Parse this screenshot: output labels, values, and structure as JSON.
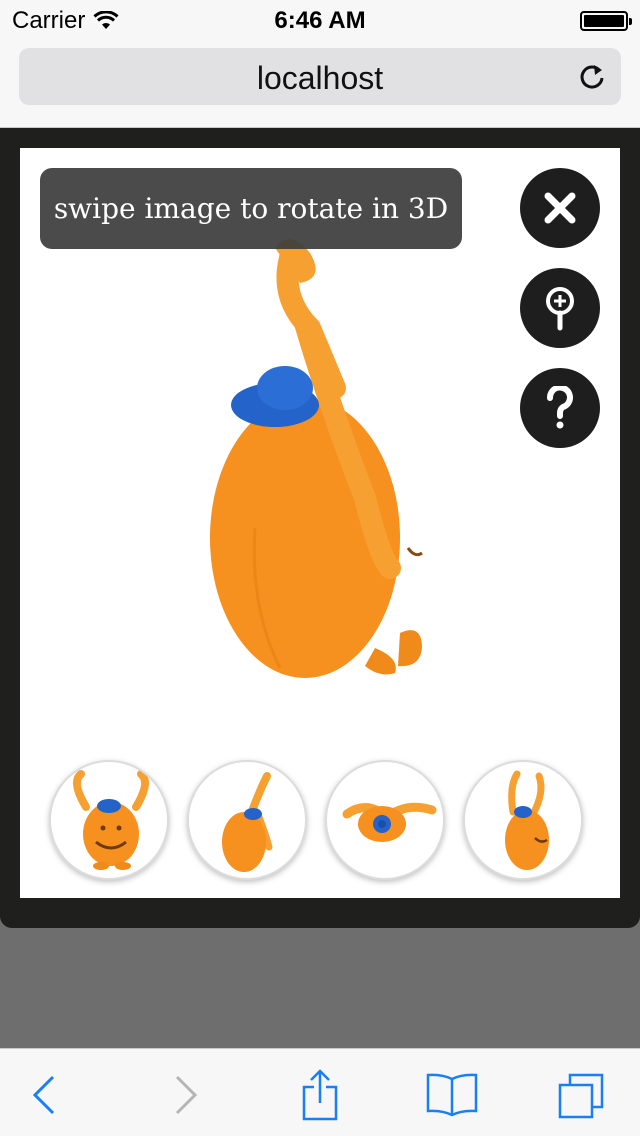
{
  "status": {
    "carrier": "Carrier",
    "time": "6:46 AM"
  },
  "browser": {
    "address": "localhost"
  },
  "viewer": {
    "hint": "swipe image to rotate in 3D"
  },
  "icons": {
    "wifi": "wifi-icon",
    "battery": "battery-icon",
    "reload": "reload-icon",
    "close": "close-icon",
    "zoom": "zoom-in-icon",
    "help": "help-icon",
    "back": "back-icon",
    "forward": "forward-icon",
    "share": "share-icon",
    "bookmarks": "bookmarks-icon",
    "tabs": "tabs-icon"
  },
  "colors": {
    "accent": "#1a7ef5",
    "overlay": "#1f1f1e",
    "product": "#f7931e",
    "hat": "#2463c9"
  }
}
